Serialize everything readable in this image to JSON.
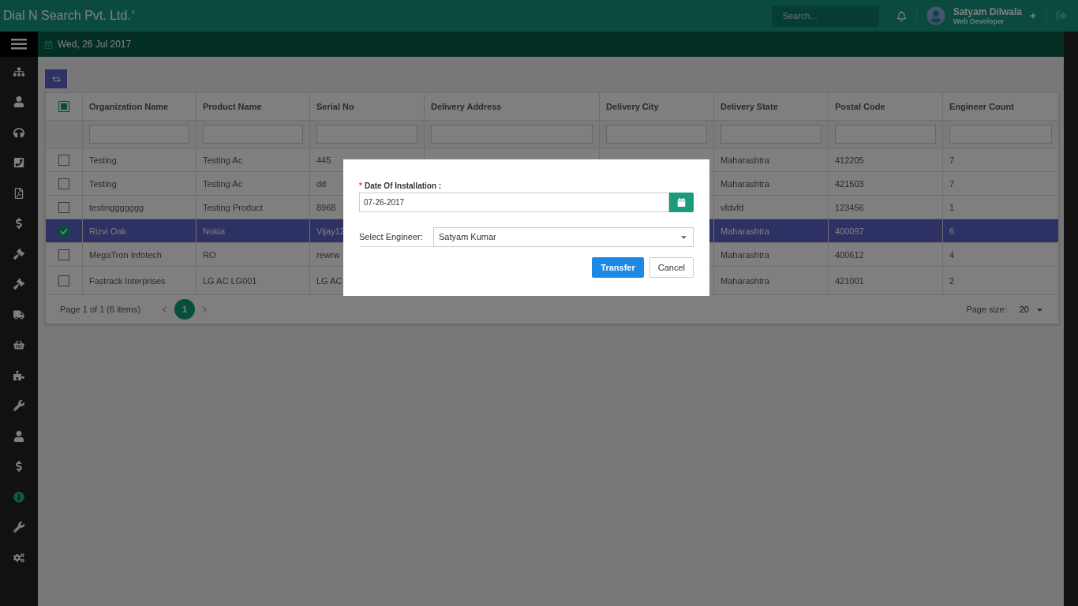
{
  "topbar": {
    "brand": "Dial N Search Pvt. Ltd.",
    "brand_mark": "s",
    "search": {
      "placeholder": "Search..."
    },
    "user": {
      "name": "Satyam Dilwala",
      "role": "Web Developer"
    }
  },
  "subheader": {
    "date": "Wed, 26 Jul 2017"
  },
  "sidebar": {
    "items": [
      {
        "selected": false
      },
      {
        "selected": false
      },
      {
        "selected": false
      },
      {
        "selected": false
      },
      {
        "selected": false
      },
      {
        "selected": false
      },
      {
        "selected": false
      },
      {
        "selected": false
      },
      {
        "selected": false
      },
      {
        "selected": false
      },
      {
        "selected": false
      },
      {
        "selected": false
      },
      {
        "selected": false
      },
      {
        "selected": false
      },
      {
        "selected": true
      },
      {
        "selected": false
      },
      {
        "selected": false
      }
    ]
  },
  "table": {
    "header_checkbox": {
      "indeterminate": true
    },
    "columns": [
      "Organization Name",
      "Product Name",
      "Serial No",
      "Delivery Address",
      "Delivery City",
      "Delivery State",
      "Postal Code",
      "Engineer Count"
    ],
    "rows": [
      {
        "selected": false,
        "cells": [
          "Testing",
          "Testing Ac",
          "445",
          null,
          null,
          "Maharashtra",
          "412205",
          "7"
        ]
      },
      {
        "selected": false,
        "cells": [
          "Testing",
          "Testing Ac",
          "dd",
          null,
          null,
          "Maharashtra",
          "421503",
          "7"
        ]
      },
      {
        "selected": false,
        "cells": [
          "testinggggggg",
          "Testing Product",
          "8968",
          null,
          null,
          "vfdvfd",
          "123456",
          "1"
        ]
      },
      {
        "selected": true,
        "cells": [
          "Rizvi Oak",
          "Nokia",
          "Vijay12",
          null,
          null,
          "Maharashtra",
          "400097",
          "6"
        ]
      },
      {
        "selected": false,
        "cells": [
          "MegaTron Infotech",
          "RO",
          "rewrw",
          null,
          null,
          "Maharashtra",
          "400612",
          "4"
        ]
      },
      {
        "selected": false,
        "cells": [
          "Fastrack Interprises",
          "LG AC LG001",
          "LG AC",
          null,
          null,
          "Maharashtra",
          "421001",
          "2"
        ]
      }
    ],
    "pager": {
      "summary": "Page 1 of 1 (6 items)",
      "pages": [
        {
          "label": "1",
          "selected": true
        }
      ],
      "page_size_label": "Page size:",
      "page_size": "20"
    }
  },
  "dialog": {
    "date_label": "Date Of Installation :",
    "required_mark": "*",
    "date_value": "07-26-2017",
    "engineer_label": "Select Engineer:",
    "engineer_value": "Satyam Kumar",
    "buttons": [
      {
        "label": "Transfer",
        "kind": "primary"
      },
      {
        "label": "Cancel",
        "kind": "secondary"
      }
    ]
  }
}
